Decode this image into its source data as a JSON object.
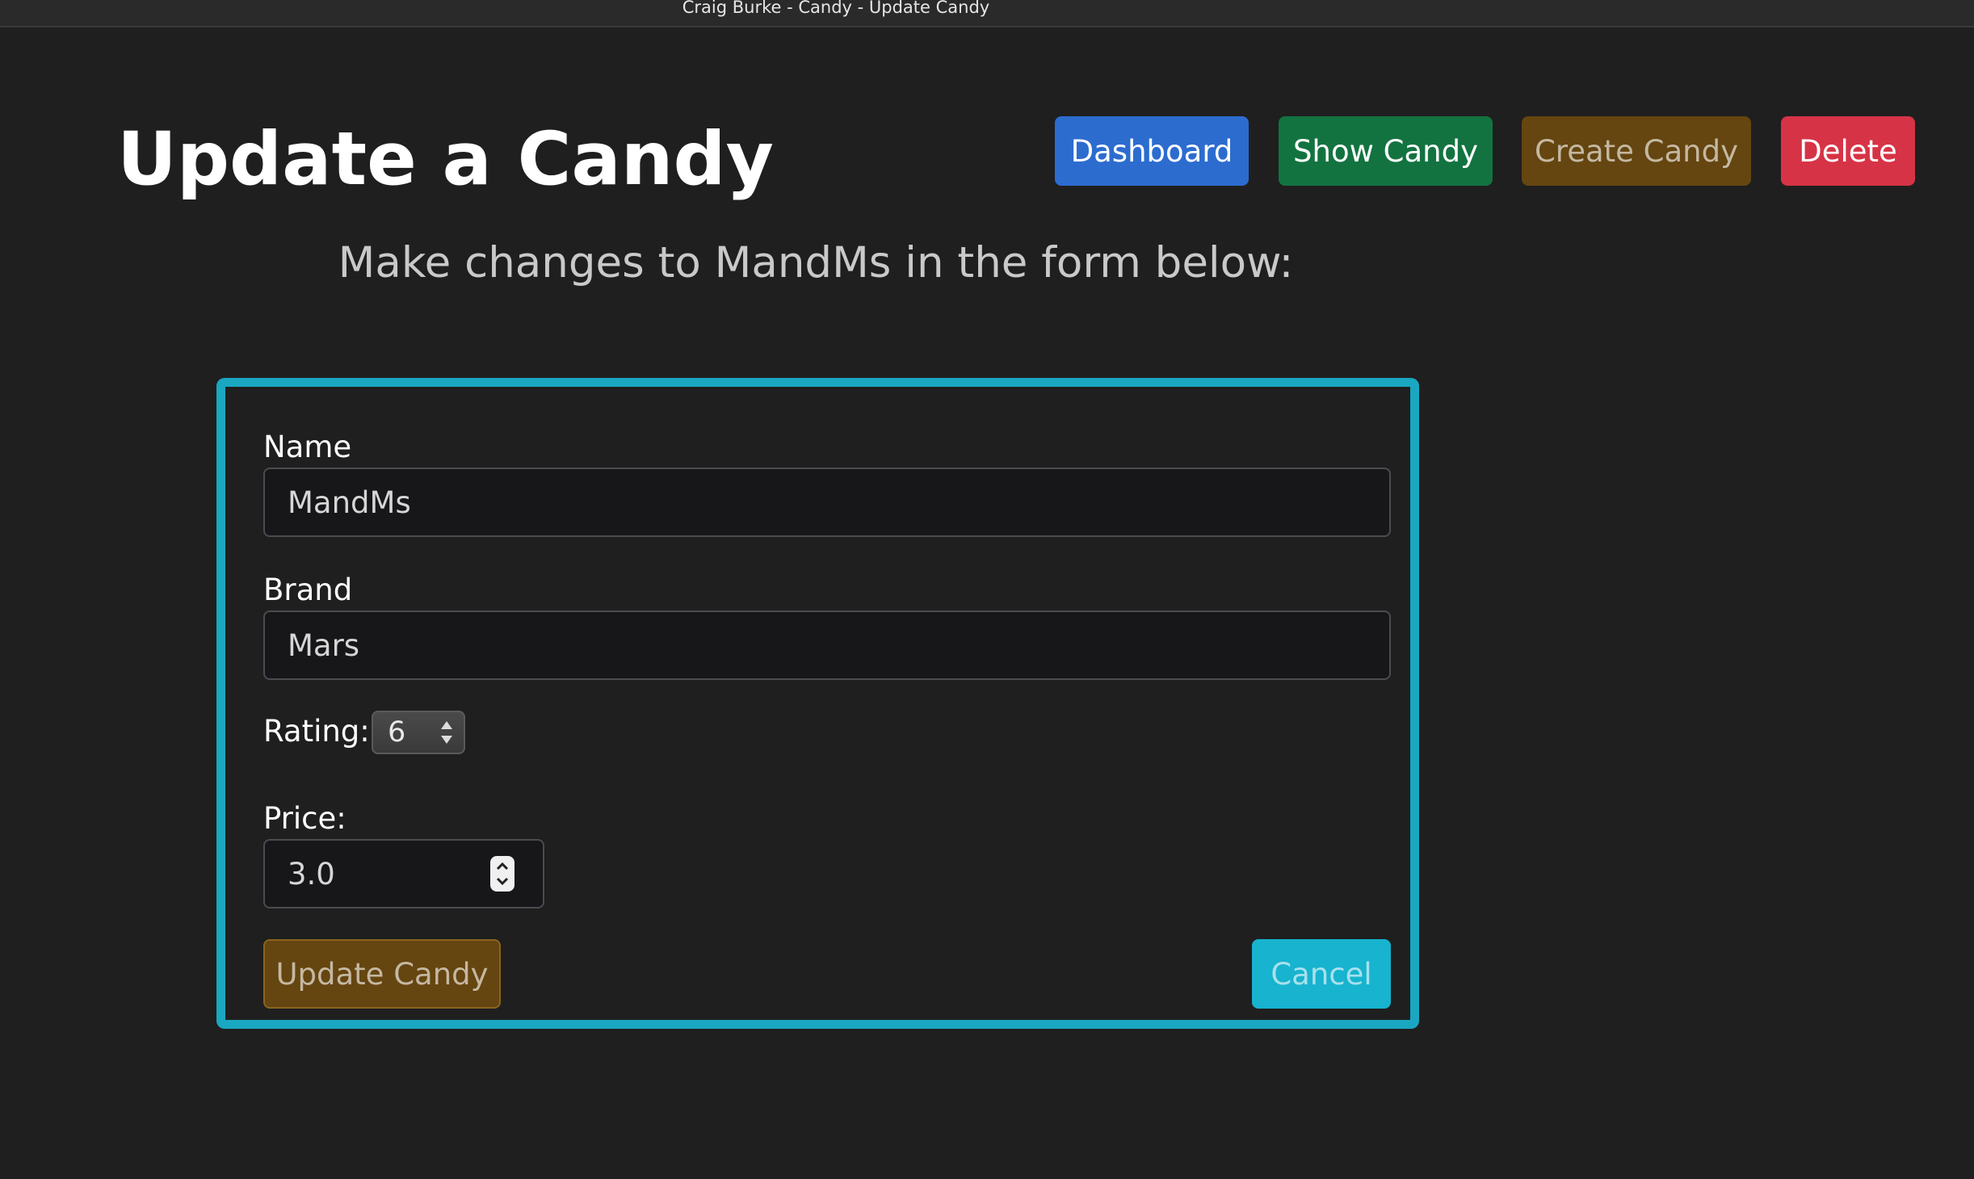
{
  "window": {
    "title": "Craig Burke - Candy - Update Candy"
  },
  "header": {
    "page_title": "Update a Candy",
    "nav": {
      "dashboard": "Dashboard",
      "show_candy": "Show Candy",
      "create_candy": "Create Candy",
      "delete": "Delete"
    }
  },
  "subtitle": "Make changes to MandMs in the form below:",
  "form": {
    "name_label": "Name",
    "name_value": "MandMs",
    "brand_label": "Brand",
    "brand_value": "Mars",
    "rating_label": "Rating:",
    "rating_value": "6",
    "price_label": "Price:",
    "price_value": "3.0",
    "update_button": "Update Candy",
    "cancel_button": "Cancel"
  },
  "colors": {
    "background": "#1f1f1f",
    "form_border": "#1aa7c2",
    "dashboard": "#2c6ccf",
    "show": "#137340",
    "create": "#654510",
    "delete": "#d73346",
    "cancel": "#17b3cf"
  }
}
